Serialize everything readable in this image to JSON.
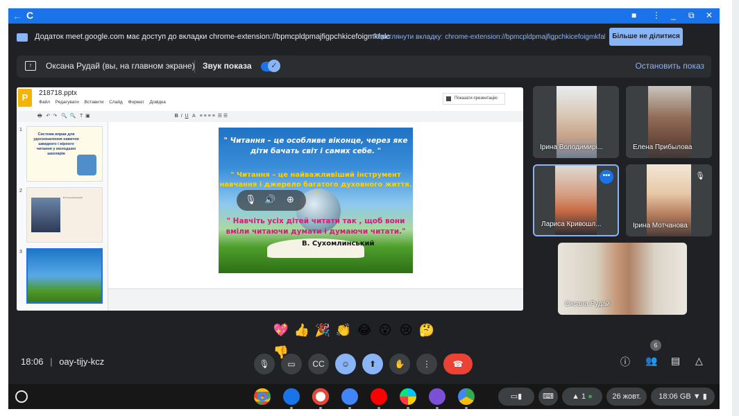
{
  "sharebar": {
    "message": "Додаток meet.google.com має доступ до вкладки chrome-extension://bpmcpldpmajfigpchkicefoigmkfalc",
    "view_tab_button": "Переглянути вкладку: chrome-extension://bpmcpldpmajfigpchkicefoigmkfalc",
    "stop_sharing_button": "Більше не ділитися"
  },
  "presenting_bar": {
    "presenter": "Оксана Рудай (вы, на главном экране)",
    "audio_label": "Звук показа",
    "audio_toggle_on": true,
    "stop_button": "Остановить показ"
  },
  "slides_app": {
    "filename": "218718.pptx",
    "menu": [
      "Файл",
      "Редагувати",
      "Вставити",
      "Слайд",
      "Формат",
      "Довідка"
    ],
    "present_button": "Показати презентацію",
    "thumbnails": [
      {
        "number": "1",
        "title": "Система вправ для удосконалення навичок швидкого і вірного читання у молодших школярів"
      },
      {
        "number": "2",
        "caption": "В.О.Сухомлинський"
      },
      {
        "number": "3"
      }
    ],
    "slide": {
      "quote1": "\" Читання – це особливе віконце, через яке діти бачать світ і самих себе. \"",
      "quote2": "\" Читання – це найважливіший інструмент навчання і джерело багатого духовного життя. \"",
      "quote3": "\" Навчіть усіх дітей читати так , щоб вони вміли читаючи думати і думаючи читати.\"",
      "author": "В. Сухомлинський"
    }
  },
  "participants": [
    {
      "name": "Ірина Володимирі...",
      "selected": false,
      "muted": false
    },
    {
      "name": "Елена Прибылова",
      "selected": false,
      "muted": false
    },
    {
      "name": "Лариса Кривошл...",
      "selected": true,
      "muted": false
    },
    {
      "name": "Ірина Мотчанова",
      "selected": false,
      "muted": true
    },
    {
      "name": "Оксана Рудай",
      "selected": false,
      "muted": false
    }
  ],
  "reactions": [
    "💖",
    "👍",
    "🎉",
    "👏",
    "😂",
    "😮",
    "😢",
    "🤔",
    "👎"
  ],
  "bottom_bar": {
    "time": "18:06",
    "separator": "|",
    "meeting_code": "oay-tijy-kcz",
    "participant_count": "6"
  },
  "shelf": {
    "date": "26 жовт.",
    "clock": "18:06",
    "locale": "GB",
    "notification_count": "1"
  },
  "colors": {
    "accent": "#1a73e8",
    "accent_light": "#8ab4f8",
    "meet_bg": "#202124",
    "hangup": "#ea4335"
  }
}
